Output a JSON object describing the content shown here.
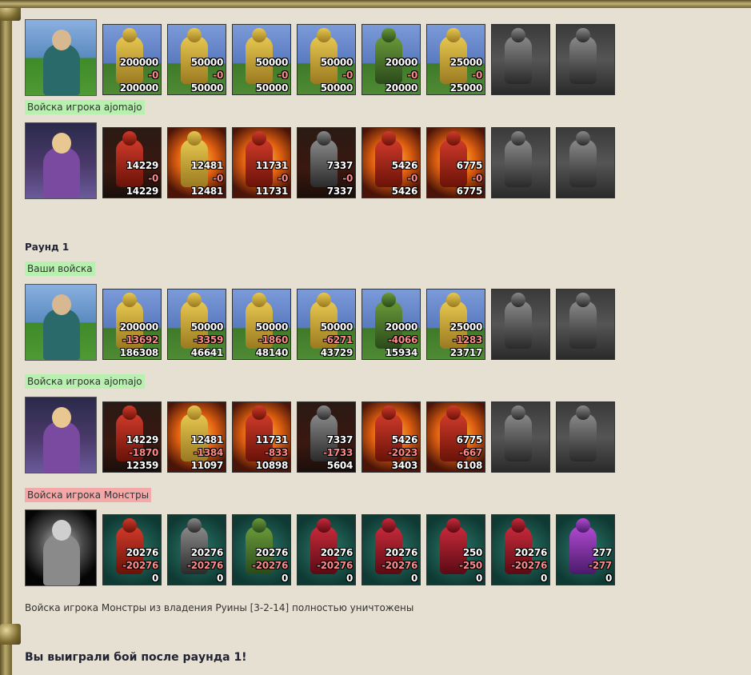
{
  "rows": [
    {
      "hero": "hero-female-teal",
      "units": [
        {
          "icon": "peasant-icon",
          "bg": "bg-blue",
          "fig": "gold",
          "a": "200000",
          "b": "-0",
          "c": "200000"
        },
        {
          "icon": "archer-icon",
          "bg": "bg-blue",
          "fig": "gold",
          "a": "50000",
          "b": "-0",
          "c": "50000"
        },
        {
          "icon": "knight-icon",
          "bg": "bg-blue",
          "fig": "gold",
          "a": "50000",
          "b": "-0",
          "c": "50000"
        },
        {
          "icon": "griffin-icon",
          "bg": "bg-blue",
          "fig": "gold",
          "a": "50000",
          "b": "-0",
          "c": "50000"
        },
        {
          "icon": "crossbowman-icon",
          "bg": "bg-blue",
          "fig": "green",
          "a": "20000",
          "b": "-0",
          "c": "20000"
        },
        {
          "icon": "paladin-icon",
          "bg": "bg-blue",
          "fig": "gold",
          "a": "25000",
          "b": "-0",
          "c": "25000"
        },
        {
          "icon": "empty-slot-icon",
          "bg": "bg-gray",
          "fig": "grey"
        },
        {
          "icon": "empty-slot-icon",
          "bg": "bg-gray",
          "fig": "grey"
        }
      ]
    },
    {
      "hero": "hero-female-blonde",
      "units": [
        {
          "icon": "dragon-icon",
          "bg": "bg-dark",
          "fig": "red",
          "a": "14229",
          "b": "-0",
          "c": "14229"
        },
        {
          "icon": "skeleton-icon",
          "bg": "bg-fire",
          "fig": "gold",
          "a": "12481",
          "b": "-0",
          "c": "12481"
        },
        {
          "icon": "fire-beast-icon",
          "bg": "bg-fire",
          "fig": "red",
          "a": "11731",
          "b": "-0",
          "c": "11731"
        },
        {
          "icon": "gargoyle-icon",
          "bg": "bg-dark",
          "fig": "grey",
          "a": "7337",
          "b": "-0",
          "c": "7337"
        },
        {
          "icon": "fire-elemental-icon",
          "bg": "bg-fire",
          "fig": "red",
          "a": "5426",
          "b": "-0",
          "c": "5426"
        },
        {
          "icon": "demon-icon",
          "bg": "bg-fire",
          "fig": "red",
          "a": "6775",
          "b": "-0",
          "c": "6775"
        },
        {
          "icon": "empty-slot-icon",
          "bg": "bg-gray",
          "fig": "grey"
        },
        {
          "icon": "empty-slot-icon",
          "bg": "bg-gray",
          "fig": "grey"
        }
      ]
    },
    {
      "hero": "hero-female-teal",
      "units": [
        {
          "icon": "peasant-icon",
          "bg": "bg-blue",
          "fig": "gold",
          "a": "200000",
          "b": "-13692",
          "c": "186308"
        },
        {
          "icon": "archer-icon",
          "bg": "bg-blue",
          "fig": "gold",
          "a": "50000",
          "b": "-3359",
          "c": "46641"
        },
        {
          "icon": "knight-icon",
          "bg": "bg-blue",
          "fig": "gold",
          "a": "50000",
          "b": "-1860",
          "c": "48140"
        },
        {
          "icon": "griffin-icon",
          "bg": "bg-blue",
          "fig": "gold",
          "a": "50000",
          "b": "-6271",
          "c": "43729"
        },
        {
          "icon": "crossbowman-icon",
          "bg": "bg-blue",
          "fig": "green",
          "a": "20000",
          "b": "-4066",
          "c": "15934"
        },
        {
          "icon": "paladin-icon",
          "bg": "bg-blue",
          "fig": "gold",
          "a": "25000",
          "b": "-1283",
          "c": "23717"
        },
        {
          "icon": "empty-slot-icon",
          "bg": "bg-gray",
          "fig": "grey"
        },
        {
          "icon": "empty-slot-icon",
          "bg": "bg-gray",
          "fig": "grey"
        }
      ]
    },
    {
      "hero": "hero-female-blonde",
      "units": [
        {
          "icon": "dragon-icon",
          "bg": "bg-dark",
          "fig": "red",
          "a": "14229",
          "b": "-1870",
          "c": "12359"
        },
        {
          "icon": "skeleton-icon",
          "bg": "bg-fire",
          "fig": "gold",
          "a": "12481",
          "b": "-1384",
          "c": "11097"
        },
        {
          "icon": "fire-beast-icon",
          "bg": "bg-fire",
          "fig": "red",
          "a": "11731",
          "b": "-833",
          "c": "10898"
        },
        {
          "icon": "gargoyle-icon",
          "bg": "bg-dark",
          "fig": "grey",
          "a": "7337",
          "b": "-1733",
          "c": "5604"
        },
        {
          "icon": "fire-elemental-icon",
          "bg": "bg-fire",
          "fig": "red",
          "a": "5426",
          "b": "-2023",
          "c": "3403"
        },
        {
          "icon": "demon-icon",
          "bg": "bg-fire",
          "fig": "red",
          "a": "6775",
          "b": "-667",
          "c": "6108"
        },
        {
          "icon": "empty-slot-icon",
          "bg": "bg-gray",
          "fig": "grey"
        },
        {
          "icon": "empty-slot-icon",
          "bg": "bg-gray",
          "fig": "grey"
        }
      ]
    },
    {
      "hero": "hero-monster-mask",
      "units": [
        {
          "icon": "lizard-beast-icon",
          "bg": "bg-teal",
          "fig": "red",
          "a": "20276",
          "b": "-20276",
          "c": "0"
        },
        {
          "icon": "golem-icon",
          "bg": "bg-teal",
          "fig": "grey",
          "a": "20276",
          "b": "-20276",
          "c": "0"
        },
        {
          "icon": "orc-icon",
          "bg": "bg-teal",
          "fig": "green",
          "a": "20276",
          "b": "-20276",
          "c": "0"
        },
        {
          "icon": "imp-icon",
          "bg": "bg-teal",
          "fig": "crim",
          "a": "20276",
          "b": "-20276",
          "c": "0"
        },
        {
          "icon": "skeletal-beast-icon",
          "bg": "bg-teal",
          "fig": "crim",
          "a": "20276",
          "b": "-20276",
          "c": "0"
        },
        {
          "icon": "dragon-icon",
          "bg": "bg-teal",
          "fig": "crim",
          "a": "250",
          "b": "-250",
          "c": "0"
        },
        {
          "icon": "banner-icon",
          "bg": "bg-teal",
          "fig": "crim",
          "a": "20276",
          "b": "-20276",
          "c": "0"
        },
        {
          "icon": "demon-icon",
          "bg": "bg-teal",
          "fig": "violet",
          "a": "277",
          "b": "-277",
          "c": "0"
        }
      ]
    }
  ],
  "labels": {
    "army_player1": "Войска игрока ajomajo",
    "round": "Раунд 1",
    "your_army": "Ваши войска",
    "army_player2": "Войска игрока ajomajo",
    "army_monsters": "Войска игрока Монстры",
    "destroyed": "Войска игрока Монстры из владения Руины [3-2-14] полностью уничтожены",
    "result": "Вы выиграли бой после раунда 1!"
  },
  "colors": {
    "tag_green": "#b8f0b0",
    "tag_red": "#f4a8a8",
    "loss": "#ff8888"
  }
}
